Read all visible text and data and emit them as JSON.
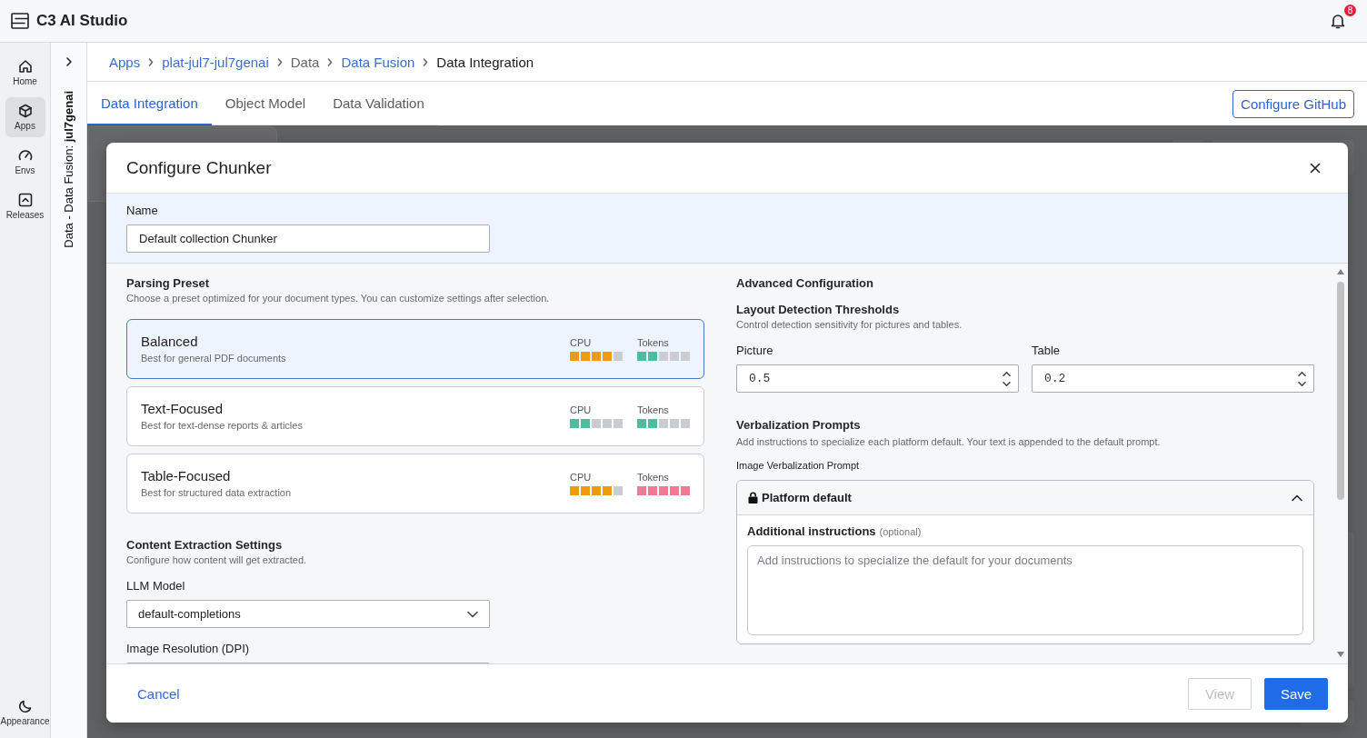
{
  "app_header": {
    "title": "C3 AI Studio",
    "notification_badge": "8"
  },
  "nav_rail": {
    "items": [
      {
        "label": "Home",
        "selected": false
      },
      {
        "label": "Apps",
        "selected": true
      },
      {
        "label": "Envs",
        "selected": false
      },
      {
        "label": "Releases",
        "selected": false
      }
    ],
    "footer_item": {
      "label": "Appearance"
    }
  },
  "context_panel": {
    "title": "Data - Data Fusion: **jul7genai**"
  },
  "breadcrumbs": [
    {
      "label": "Apps",
      "kind": "link"
    },
    {
      "label": "plat-jul7-jul7genai",
      "kind": "link"
    },
    {
      "label": "Data",
      "kind": "plain"
    },
    {
      "label": "Data Fusion",
      "kind": "link"
    },
    {
      "label": "Data Integration",
      "kind": "current"
    }
  ],
  "tabs": [
    {
      "label": "Data Integration",
      "selected": true
    },
    {
      "label": "Object Model",
      "selected": false
    },
    {
      "label": "Data Validation",
      "selected": false
    }
  ],
  "toolbar": {
    "button": "Configure GitHub"
  },
  "dialog": {
    "title": "Configure Chunker",
    "name_field": {
      "label": "Name",
      "value": "Default collection Chunker"
    },
    "parsing_preset": {
      "heading": "Parsing Preset",
      "description": "Choose a preset optimized for your document types. You can customize settings after selection.",
      "presets": [
        {
          "title": "Balanced",
          "description": "Best for general PDF documents",
          "selected": true,
          "meters": [
            {
              "label": "CPU",
              "level": 0.8,
              "color": "#ef9a10"
            },
            {
              "label": "Tokens",
              "level": 0.4,
              "color": "#4cbea0"
            }
          ]
        },
        {
          "title": "Text-Focused",
          "description": "Best for text-dense reports & articles",
          "selected": false,
          "meters": [
            {
              "label": "CPU",
              "level": 0.4,
              "color": "#4cbea0"
            },
            {
              "label": "Tokens",
              "level": 0.4,
              "color": "#4cbea0"
            }
          ]
        },
        {
          "title": "Table-Focused",
          "description": "Best for structured data extraction",
          "selected": false,
          "meters": [
            {
              "label": "CPU",
              "level": 0.8,
              "color": "#ef9a10"
            },
            {
              "label": "Tokens",
              "level": 1,
              "color": "#f27a93"
            }
          ]
        }
      ]
    },
    "content_extraction": {
      "heading": "Content Extraction Settings",
      "description": "Configure how content will get extracted.",
      "llm_model": {
        "label": "LLM Model",
        "value": "default-completions"
      },
      "image_resolution": {
        "label": "Image Resolution (DPI)"
      }
    },
    "advanced": {
      "heading": "Advanced Configuration",
      "layout_detection": {
        "heading": "Layout Detection Thresholds",
        "description": "Control detection sensitivity for pictures and tables.",
        "fields": [
          {
            "label": "Picture",
            "value": "0.5"
          },
          {
            "label": "Table",
            "value": "0.2"
          }
        ]
      },
      "verbalization": {
        "heading": "Verbalization Prompts",
        "description": "Add instructions to specialize each platform default. Your text is appended to the default prompt.",
        "prompts": [
          {
            "label": "Image Verbalization Prompt",
            "summary": "Platform default",
            "expanded": true,
            "instructions_label": "Additional instructions",
            "instructions_hint": "(optional)",
            "placeholder": "Add instructions to specialize the default for your documents"
          }
        ]
      }
    },
    "footer": {
      "cancel": "Cancel",
      "buttons": [
        {
          "label": "View",
          "kind": "secondary",
          "disabled": true
        },
        {
          "label": "Save",
          "kind": "primary",
          "disabled": false
        }
      ]
    }
  }
}
